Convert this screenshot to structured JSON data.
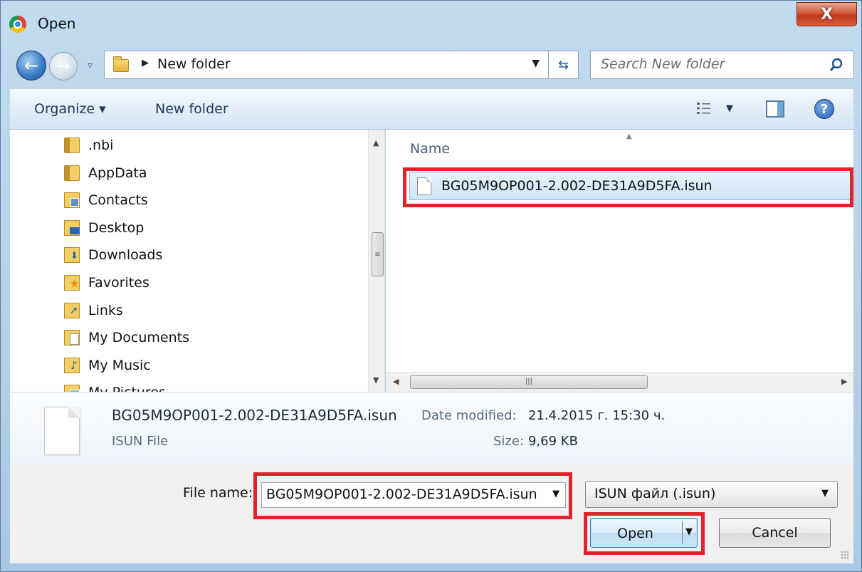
{
  "window": {
    "title": "Open",
    "close_label": "X"
  },
  "address": {
    "path": "New folder",
    "search_placeholder": "Search New folder"
  },
  "toolbar": {
    "organize_label": "Organize ▾",
    "new_folder_label": "New folder"
  },
  "nav_tree": {
    "items": [
      {
        "label": ".nbi",
        "icon": "folder-icon"
      },
      {
        "label": "AppData",
        "icon": "folder-icon"
      },
      {
        "label": "Contacts",
        "icon": "contacts-folder-icon"
      },
      {
        "label": "Desktop",
        "icon": "desktop-folder-icon"
      },
      {
        "label": "Downloads",
        "icon": "downloads-folder-icon"
      },
      {
        "label": "Favorites",
        "icon": "favorites-folder-icon"
      },
      {
        "label": "Links",
        "icon": "links-folder-icon"
      },
      {
        "label": "My Documents",
        "icon": "documents-folder-icon"
      },
      {
        "label": "My Music",
        "icon": "music-folder-icon"
      },
      {
        "label": "My Pictures",
        "icon": "pictures-folder-icon"
      }
    ]
  },
  "file_list": {
    "column_name": "Name",
    "files": [
      {
        "name": "BG05M9OP001-2.002-DE31A9D5FA.isun"
      }
    ]
  },
  "details": {
    "file_name": "BG05M9OP001-2.002-DE31A9D5FA.isun",
    "file_type": "ISUN File",
    "date_label": "Date modified:",
    "date_value": "21.4.2015 г. 15:30 ч.",
    "size_label": "Size:",
    "size_value": "9,69 KB"
  },
  "footer": {
    "file_name_label": "File name:",
    "file_name_value": "BG05M9OP001-2.002-DE31A9D5FA.isun",
    "file_type_value": "ISUN файл (.isun)",
    "open_label": "Open",
    "cancel_label": "Cancel"
  },
  "colors": {
    "highlight": "#e0242b",
    "selection": "#cfe3f7",
    "chrome": "#bcd6ea"
  }
}
